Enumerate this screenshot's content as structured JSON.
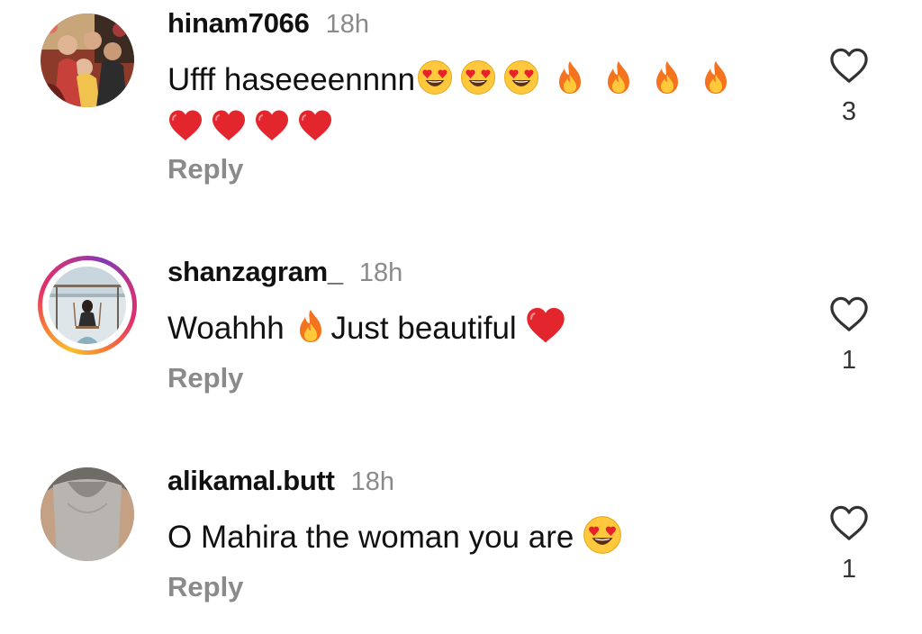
{
  "comments": [
    {
      "username": "hinam7066",
      "time": "18h",
      "text_line1": "Ufff haseeeennnn",
      "text_line1_emojis": [
        "heart-eyes-emoji",
        "heart-eyes-emoji",
        "heart-eyes-emoji",
        "fire-emoji",
        "fire-emoji",
        "fire-emoji",
        "fire-emoji"
      ],
      "text_line2_emojis": [
        "red-heart-emoji",
        "red-heart-emoji",
        "red-heart-emoji",
        "red-heart-emoji"
      ],
      "reply_label": "Reply",
      "like_count": "3"
    },
    {
      "username": "shanzagram_",
      "time": "18h",
      "text_part1": "Woahhh ",
      "text_part2": "Just beautiful ",
      "text_emojis": [
        "fire-emoji",
        "red-heart-emoji"
      ],
      "reply_label": "Reply",
      "like_count": "1",
      "has_story_ring": true
    },
    {
      "username": "alikamal.butt",
      "time": "18h",
      "text": "O Mahira the woman you are ",
      "text_emojis": [
        "heart-eyes-emoji"
      ],
      "reply_label": "Reply",
      "like_count": "1"
    }
  ],
  "colors": {
    "secondary_text": "#8a8a8a",
    "primary_text": "#111111",
    "story_ring": [
      "#f9c02e",
      "#e1306c",
      "#833ab4"
    ]
  },
  "icons": {
    "like": "heart-outline-icon"
  }
}
